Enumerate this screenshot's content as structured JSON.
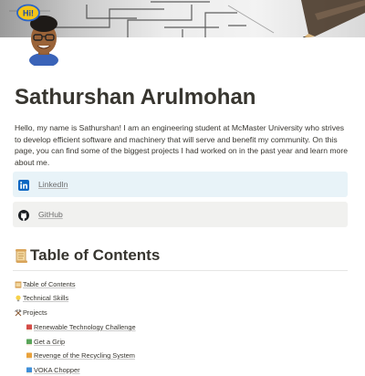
{
  "page": {
    "title": "Sathurshan Arulmohan",
    "intro": "Hello, my name is Sathurshan! I am an engineering student at McMaster University who strives to develop efficient software and machinery that will serve and benefit my community. On this page, you can find some of the biggest projects I had worked on in the past year and learn more about me."
  },
  "cover": {
    "badge_text": "Hi!"
  },
  "links": {
    "linkedin": {
      "label": "LinkedIn",
      "icon": "linkedin-icon",
      "color": "#0a66c2"
    },
    "github": {
      "label": "GitHub",
      "icon": "github-icon",
      "color": "#1b1f23"
    }
  },
  "toc": {
    "heading": "Table of Contents",
    "heading_icon": "scroll-icon",
    "items": [
      {
        "label": "Table of Contents",
        "icon": "scroll-icon"
      },
      {
        "label": "Technical Skills",
        "icon": "lightbulb-icon"
      },
      {
        "label": "Projects",
        "icon": "hammer-pick-icon"
      },
      {
        "label": "Renewable Technology Challenge",
        "icon": "red-book-icon"
      },
      {
        "label": "Get a Grip",
        "icon": "green-book-icon"
      },
      {
        "label": "Revenge of the Recycling System",
        "icon": "orange-book-icon"
      },
      {
        "label": "VOKA Chopper",
        "icon": "blue-book-icon"
      }
    ]
  },
  "colors": {
    "text": "#37352f",
    "linkedin_bg": "#e8f3f8",
    "github_bg": "#f1f1ef",
    "book_red": "#d44c47",
    "book_green": "#5aa55a",
    "book_orange": "#e9a23b",
    "book_blue": "#3f8fd8"
  }
}
